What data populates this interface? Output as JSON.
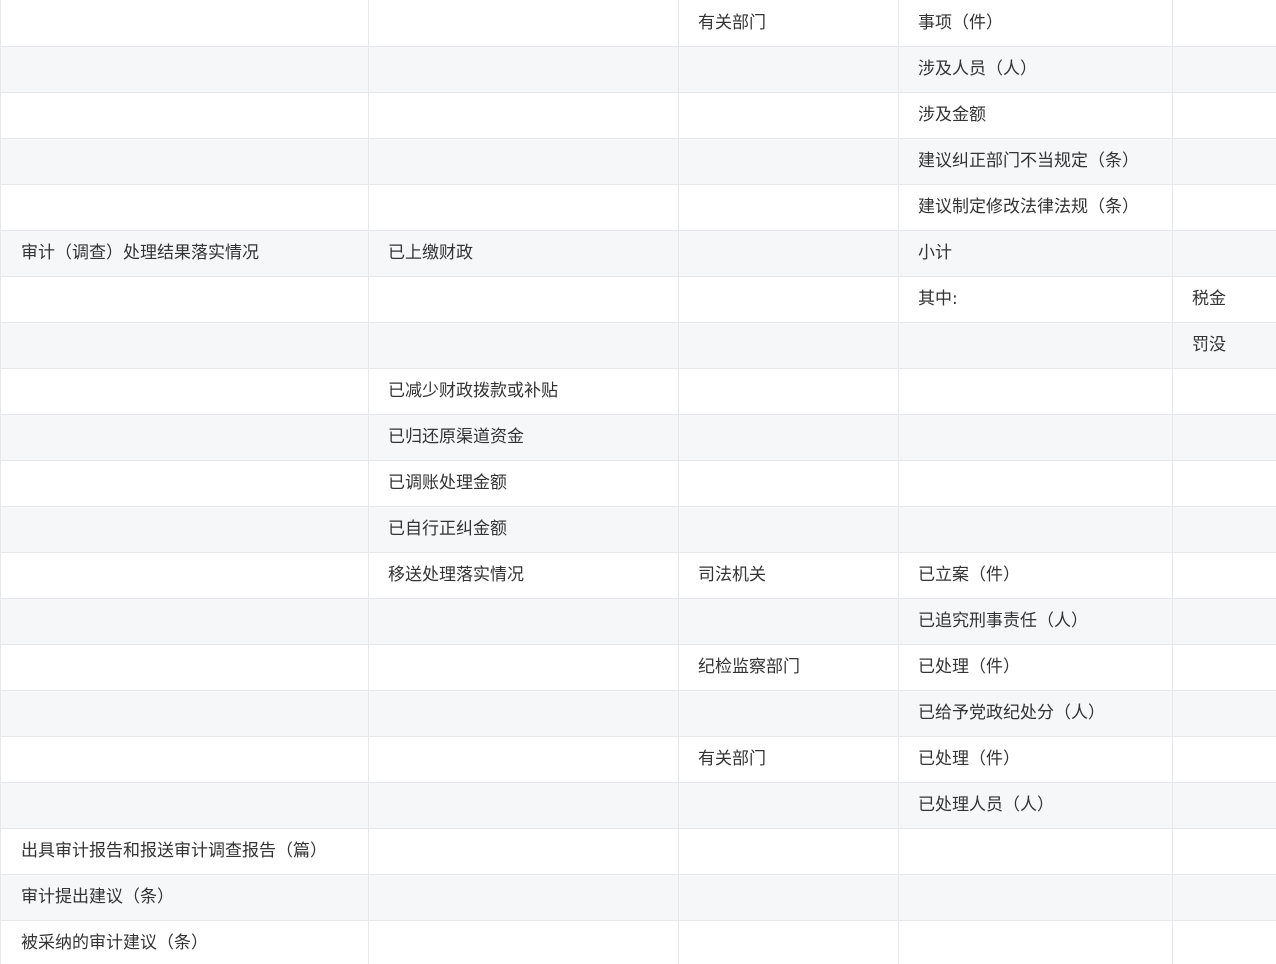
{
  "table": {
    "rows": [
      [
        "",
        "",
        "有关部门",
        "事项（件）",
        ""
      ],
      [
        "",
        "",
        "",
        "涉及人员（人）",
        ""
      ],
      [
        "",
        "",
        "",
        "涉及金额",
        ""
      ],
      [
        "",
        "",
        "",
        "建议纠正部门不当规定（条）",
        ""
      ],
      [
        "",
        "",
        "",
        "建议制定修改法律法规（条）",
        ""
      ],
      [
        "审计（调查）处理结果落实情况",
        "已上缴财政",
        "",
        "小计",
        ""
      ],
      [
        "",
        "",
        "",
        "其中:",
        "税金"
      ],
      [
        "",
        "",
        "",
        "",
        "罚没"
      ],
      [
        "",
        "已减少财政拨款或补贴",
        "",
        "",
        ""
      ],
      [
        "",
        "已归还原渠道资金",
        "",
        "",
        ""
      ],
      [
        "",
        "已调账处理金额",
        "",
        "",
        ""
      ],
      [
        "",
        "已自行正纠金额",
        "",
        "",
        ""
      ],
      [
        "",
        "移送处理落实情况",
        "司法机关",
        "已立案（件）",
        ""
      ],
      [
        "",
        "",
        "",
        "已追究刑事责任（人）",
        ""
      ],
      [
        "",
        "",
        "纪检监察部门",
        "已处理（件）",
        ""
      ],
      [
        "",
        "",
        "",
        "已给予党政纪处分（人）",
        ""
      ],
      [
        "",
        "",
        "有关部门",
        "已处理（件）",
        ""
      ],
      [
        "",
        "",
        "",
        "已处理人员（人）",
        ""
      ],
      [
        "出具审计报告和报送审计调查报告（篇）",
        "",
        "",
        "",
        ""
      ],
      [
        "审计提出建议（条）",
        "",
        "",
        "",
        ""
      ],
      [
        "被采纳的审计建议（条）",
        "",
        "",
        "",
        ""
      ]
    ]
  }
}
